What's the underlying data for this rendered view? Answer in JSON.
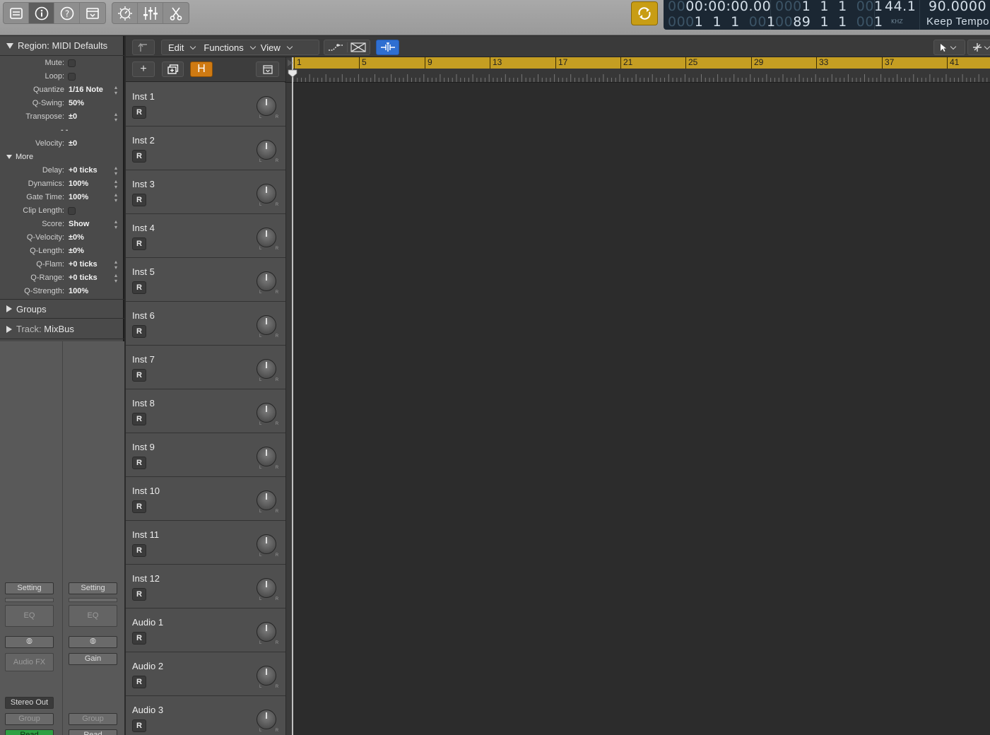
{
  "control_bar": {
    "buttons": [
      {
        "name": "library-icon",
        "label": "Library"
      },
      {
        "name": "inspector-icon",
        "label": "Inspector",
        "active": true
      },
      {
        "name": "quick-help-icon",
        "label": "Quick Help"
      },
      {
        "name": "toolbar-icon",
        "label": "Toolbar"
      }
    ],
    "edit_buttons": [
      {
        "name": "smart-controls-icon",
        "label": "Smart Controls"
      },
      {
        "name": "mixer-icon",
        "label": "Mixer"
      },
      {
        "name": "editors-icon",
        "label": "Editors"
      }
    ],
    "cycle_color": "#c89d14"
  },
  "lcd": {
    "time": "00:00:00.00",
    "time_prefix": "00",
    "smpte_row": "0001 1 1 001 1",
    "pos_top": "1  1  1",
    "pos_top_prefix": "0001",
    "pos_top_sub": "001",
    "pos_top_end": "1",
    "pos_bottom_prefix": "0001",
    "pos_bottom": "1  1  1",
    "pos_bottom_sub": "001",
    "pos_bottom_end": "1",
    "end_top_prefix": "0089",
    "end_top": "89  1  1",
    "sample_rate": "44.1",
    "sample_rate_unit": "KHZ",
    "tempo": "90.0000",
    "tempo_mode": "Keep Tempo"
  },
  "inspector": {
    "region_header_label": "Region:",
    "region_header_value": "MIDI Defaults",
    "params": [
      {
        "label": "Mute:",
        "value": "",
        "type": "check"
      },
      {
        "label": "Loop:",
        "value": "",
        "type": "check"
      },
      {
        "label": "Quantize",
        "value": "1/16 Note",
        "type": "stepper"
      },
      {
        "label": "Q-Swing:",
        "value": "50%",
        "type": "text"
      },
      {
        "label": "Transpose:",
        "value": "±0",
        "type": "stepper"
      },
      {
        "label": "",
        "value": "- -",
        "type": "text"
      },
      {
        "label": "Velocity:",
        "value": "±0",
        "type": "text"
      }
    ],
    "more_label": "More",
    "more_params": [
      {
        "label": "Delay:",
        "value": "+0 ticks",
        "type": "stepper"
      },
      {
        "label": "Dynamics:",
        "value": "100%",
        "type": "stepper"
      },
      {
        "label": "Gate Time:",
        "value": "100%",
        "type": "stepper"
      },
      {
        "label": "Clip Length:",
        "value": "",
        "type": "check"
      },
      {
        "label": "Score:",
        "value": "Show",
        "type": "stepper"
      },
      {
        "label": "Q-Velocity:",
        "value": "±0%",
        "type": "text"
      },
      {
        "label": "Q-Length:",
        "value": "±0%",
        "type": "text"
      },
      {
        "label": "Q-Flam:",
        "value": "+0 ticks",
        "type": "stepper"
      },
      {
        "label": "Q-Range:",
        "value": "+0 ticks",
        "type": "stepper"
      },
      {
        "label": "Q-Strength:",
        "value": "100%",
        "type": "text"
      }
    ],
    "groups_label": "Groups",
    "track_label": "Track:",
    "track_value": "MixBus",
    "strip_a": {
      "setting": "Setting",
      "eq": "EQ",
      "fx": "Audio FX",
      "output": "Stereo Out",
      "group": "Group",
      "read": "Read"
    },
    "strip_b": {
      "setting": "Setting",
      "eq": "EQ",
      "fx": "Gain",
      "group": "Group",
      "read": "Read"
    },
    "read_color": "#2ea043"
  },
  "local_bar": {
    "back_icon": "back-arrow-icon",
    "menus": [
      "Edit",
      "Functions",
      "View"
    ],
    "pointer_tool": "pointer-icon",
    "pencil_tool": "pencil-icon"
  },
  "track_tools": {
    "add": "+",
    "h_label": "H"
  },
  "tracks": [
    {
      "name": "Inst 1"
    },
    {
      "name": "Inst 2"
    },
    {
      "name": "Inst 3"
    },
    {
      "name": "Inst 4"
    },
    {
      "name": "Inst 5"
    },
    {
      "name": "Inst 6"
    },
    {
      "name": "Inst 7"
    },
    {
      "name": "Inst 8"
    },
    {
      "name": "Inst 9"
    },
    {
      "name": "Inst 10"
    },
    {
      "name": "Inst 11"
    },
    {
      "name": "Inst 12"
    },
    {
      "name": "Audio 1"
    },
    {
      "name": "Audio 2"
    },
    {
      "name": "Audio 3"
    }
  ],
  "track_record_label": "R",
  "track_pan_label": "L R",
  "ruler": {
    "bars": [
      "1",
      "5",
      "9",
      "13",
      "17",
      "21",
      "25",
      "29",
      "33",
      "37",
      "41"
    ],
    "color": "#c59e22"
  }
}
